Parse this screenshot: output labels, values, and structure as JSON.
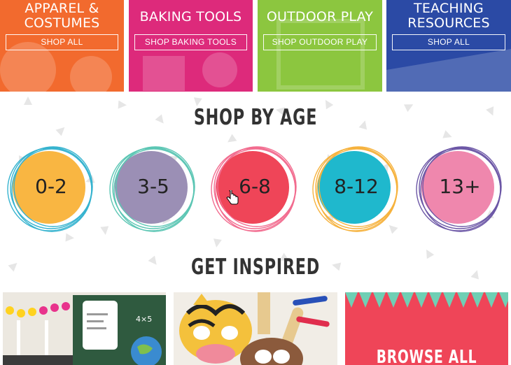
{
  "categories": [
    {
      "title": "APPAREL & COSTUMES",
      "title_lines": [
        "APPAREL &",
        "COSTUMES"
      ],
      "button": "SHOP ALL",
      "color": "#f26a2e"
    },
    {
      "title": "BAKING TOOLS",
      "title_lines": [
        "BAKING TOOLS"
      ],
      "button": "SHOP BAKING TOOLS",
      "color": "#dd2a7b"
    },
    {
      "title": "OUTDOOR PLAY",
      "title_lines": [
        "OUTDOOR PLAY"
      ],
      "button": "SHOP OUTDOOR PLAY",
      "color": "#8cc63f"
    },
    {
      "title": "TEACHING RESOURCES",
      "title_lines": [
        "TEACHING",
        "RESOURCES"
      ],
      "button": "SHOP ALL",
      "color": "#2b4aa5"
    }
  ],
  "shop_by_age": {
    "heading": "SHOP BY AGE",
    "ages": [
      {
        "label": "0-2",
        "fill": "#f9b642",
        "ring": "#36b3cf"
      },
      {
        "label": "3-5",
        "fill": "#9b8fb5",
        "ring": "#5cc6b4"
      },
      {
        "label": "6-8",
        "fill": "#ef4558",
        "ring": "#f26c8f"
      },
      {
        "label": "8-12",
        "fill": "#1fb8cd",
        "ring": "#f6b23d"
      },
      {
        "label": "13+",
        "fill": "#ef87ad",
        "ring": "#6c57a6"
      }
    ]
  },
  "get_inspired": {
    "heading": "GET INSPIRED",
    "tiles": [
      {
        "alt": "classroom chalkboard scene"
      },
      {
        "alt": "animal mask crafts"
      },
      {
        "label": "BROWSE ALL",
        "color": "#ef4558",
        "accent": "#6fcfb4"
      }
    ]
  }
}
